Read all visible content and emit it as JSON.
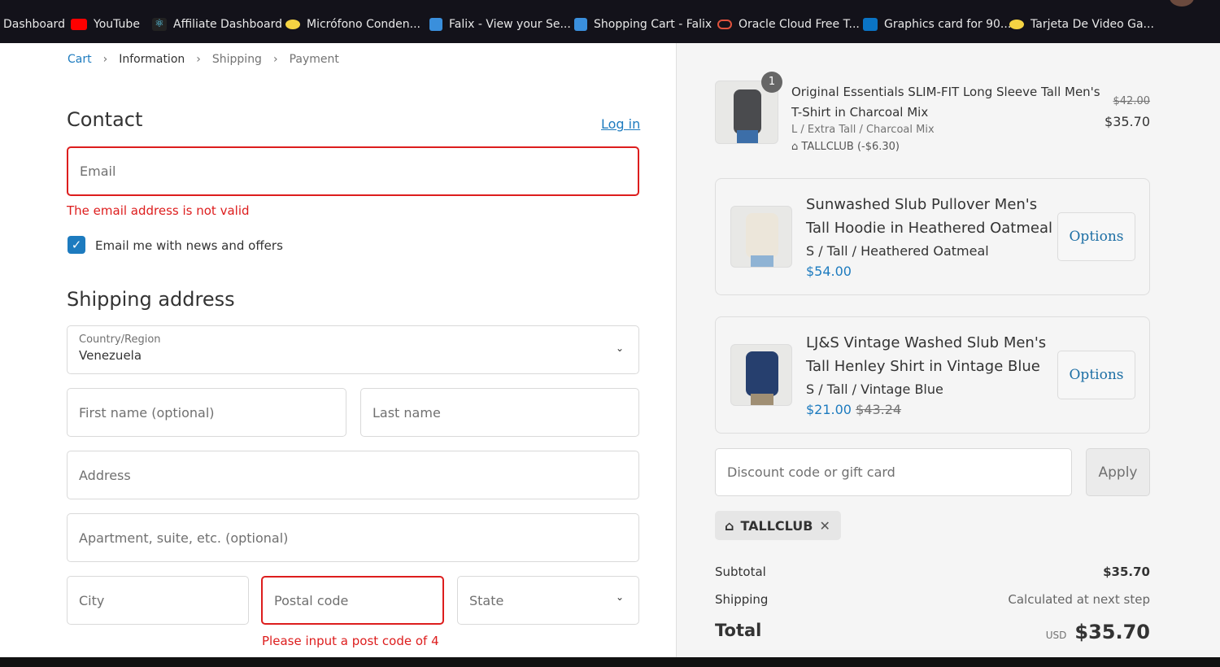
{
  "bookmarks": [
    {
      "label": "Dashboard",
      "icon": "none"
    },
    {
      "label": "YouTube",
      "icon": "youtube-icon"
    },
    {
      "label": "Affiliate Dashboard",
      "icon": "react-icon"
    },
    {
      "label": "Micrófono Conden...",
      "icon": "mercadolibre-icon"
    },
    {
      "label": "Falix - View your Se...",
      "icon": "falix-icon"
    },
    {
      "label": "Shopping Cart - Falix",
      "icon": "falix-icon"
    },
    {
      "label": "Oracle Cloud Free T...",
      "icon": "oracle-icon"
    },
    {
      "label": "Graphics card for 90...",
      "icon": "dell-icon"
    },
    {
      "label": "Tarjeta De Video Ga...",
      "icon": "mercadolibre-icon"
    }
  ],
  "breadcrumb": [
    "Cart",
    "Information",
    "Shipping",
    "Payment"
  ],
  "contact": {
    "title": "Contact",
    "login": "Log in",
    "email_placeholder": "Email",
    "email_error": "The email address is not valid",
    "newsletter": "Email me with news and offers",
    "newsletter_checked": true
  },
  "shipping": {
    "title": "Shipping address",
    "country_label": "Country/Region",
    "country": "Venezuela",
    "first_name": "First name (optional)",
    "last_name": "Last name",
    "address": "Address",
    "apartment": "Apartment, suite, etc. (optional)",
    "city": "City",
    "postal": "Postal code",
    "state": "State",
    "postal_error": "Please input a post code of 4"
  },
  "cart": {
    "item": {
      "qty": "1",
      "title1": "Original Essentials SLIM-FIT Long Sleeve Tall Men's",
      "title2": "T-Shirt in Charcoal Mix",
      "variant": "L / Extra Tall / Charcoal Mix",
      "discount": "TALLCLUB (-$6.30)",
      "old_price": "$42.00",
      "price": "$35.70"
    },
    "upsells": [
      {
        "title1": "Sunwashed Slub Pullover Men's",
        "title2": "Tall Hoodie in Heathered Oatmeal",
        "variant": "S / Tall / Heathered Oatmeal",
        "price": "$54.00",
        "old_price": "",
        "button": "Options"
      },
      {
        "title1": "LJ&S Vintage Washed Slub Men's",
        "title2": "Tall Henley Shirt in Vintage Blue",
        "variant": "S / Tall / Vintage Blue",
        "price": "$21.00",
        "old_price": "$43.24",
        "button": "Options"
      }
    ],
    "discount_placeholder": "Discount code or gift card",
    "apply": "Apply",
    "code": "TALLCLUB",
    "subtotal_label": "Subtotal",
    "subtotal": "$35.70",
    "shipping_label": "Shipping",
    "shipping_value": "Calculated at next step",
    "total_label": "Total",
    "currency": "USD",
    "total": "$35.70"
  }
}
